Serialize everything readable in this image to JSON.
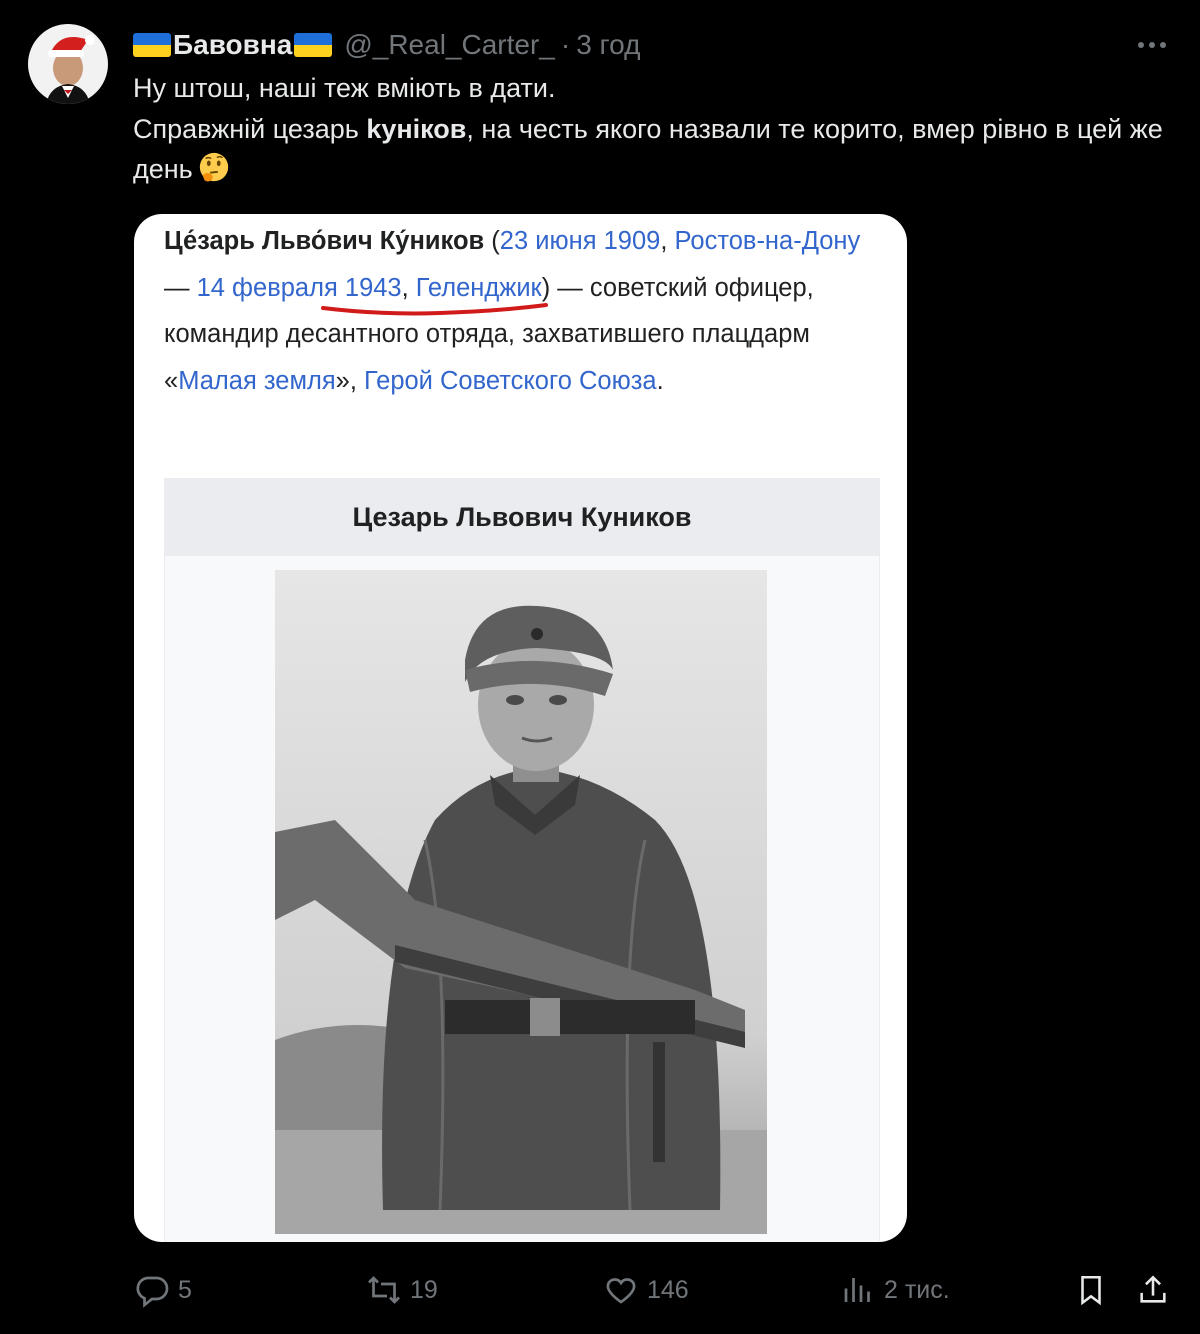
{
  "author": {
    "display_name": "Бавовна",
    "handle": "@_Real_Carter_",
    "separator": "·",
    "time": "3 год"
  },
  "tweet": {
    "line1": "Ну штош, наші теж вміють в дати.",
    "line2_pre": "Справжній цезарь ",
    "line2_bold": "kуніков",
    "line2_post": ", на честь якого назвали те корито, вмер рівно в цей же день",
    "emoji": "thinking-face"
  },
  "wiki": {
    "name": "Це́зарь Льво́вич Ку́ников",
    "open_paren": " (",
    "birth_date": "23 июня 1909",
    "comma1": ", ",
    "birth_place": "Ростов-на-Дону",
    "dash1": " — ",
    "death_date": "14 февраля 1943",
    "comma2": ", ",
    "death_place": "Геленджик",
    "close_paren": ") — советский офицер, командир десантного отряда, захватившего плацдарм «",
    "malaya_zemlya": "Малая земля",
    "after_mz": "», ",
    "hero": "Герой Советского Союза",
    "period": ".",
    "infobox_title": "Цезарь Львович Куников",
    "link_color": "#3366cc",
    "underline_color": "#d11a1a"
  },
  "actions": {
    "replies": "5",
    "retweets": "19",
    "likes": "146",
    "views": "2 тис."
  },
  "colors": {
    "background": "#000000",
    "text": "#e7e9ea",
    "muted": "#71767b"
  }
}
